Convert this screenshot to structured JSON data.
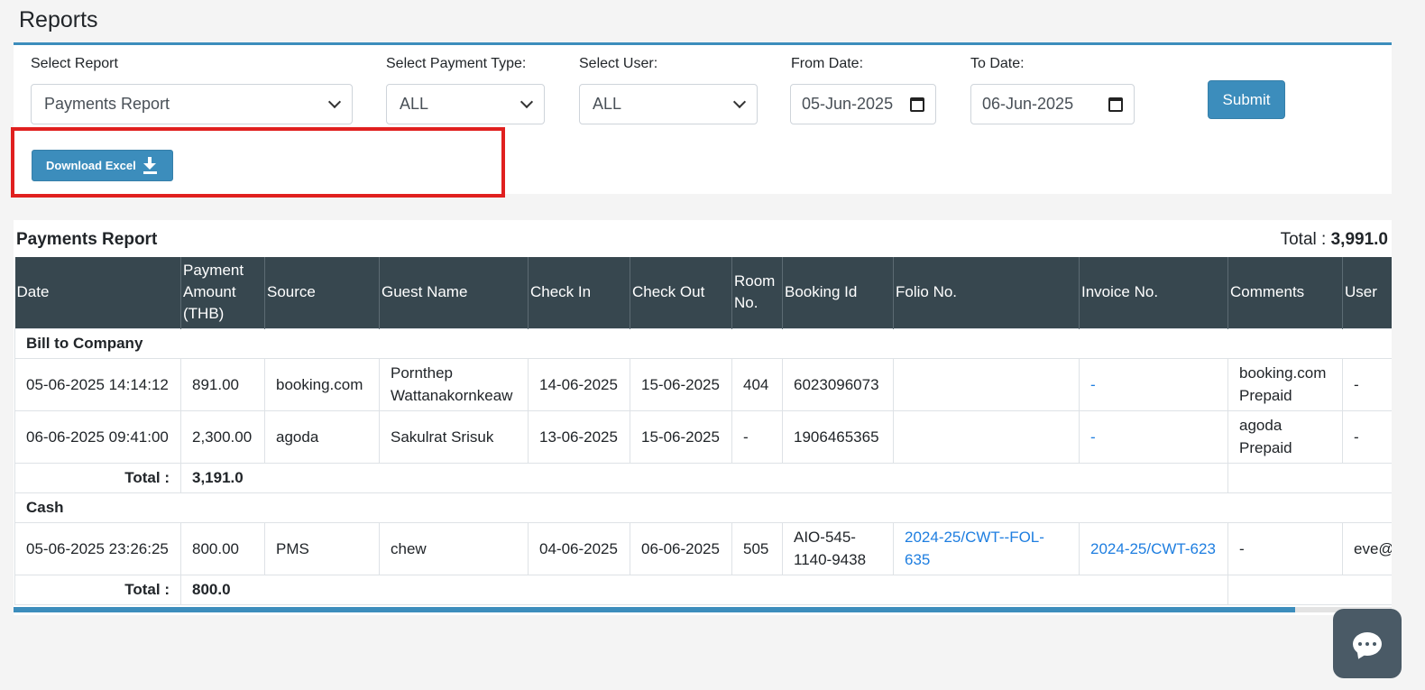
{
  "page": {
    "title": "Reports"
  },
  "filters": {
    "report_label": "Select Report",
    "report_value": "Payments Report",
    "payment_type_label": "Select Payment Type:",
    "payment_type_value": "ALL",
    "user_label": "Select User:",
    "user_value": "ALL",
    "from_label": "From Date:",
    "from_value": "05-Jun-2025",
    "to_label": "To Date:",
    "to_value": "06-Jun-2025",
    "submit_label": "Submit",
    "download_label": "Download Excel"
  },
  "report": {
    "title": "Payments Report",
    "total_label": "Total :",
    "total_value": "3,991.0",
    "columns": [
      "Date",
      "Payment Amount (THB)",
      "Source",
      "Guest Name",
      "Check In",
      "Check Out",
      "Room No.",
      "Booking Id",
      "Folio No.",
      "Invoice No.",
      "Comments",
      "User"
    ],
    "groups": [
      {
        "name": "Bill to Company",
        "rows": [
          {
            "date": "05-06-2025 14:14:12",
            "amount": "891.00",
            "source": "booking.com",
            "guest": "Pornthep Wattanakornkeaw",
            "check_in": "14-06-2025",
            "check_out": "15-06-2025",
            "room": "404",
            "booking_id": "6023096073",
            "folio": "",
            "invoice": "-",
            "comments": "booking.com Prepaid",
            "user": "-"
          },
          {
            "date": "06-06-2025 09:41:00",
            "amount": "2,300.00",
            "source": "agoda",
            "guest": "Sakulrat Srisuk",
            "check_in": "13-06-2025",
            "check_out": "15-06-2025",
            "room": "-",
            "booking_id": "1906465365",
            "folio": "",
            "invoice": "-",
            "comments": "agoda Prepaid",
            "user": "-"
          }
        ],
        "total_label": "Total :",
        "total": "3,191.0"
      },
      {
        "name": "Cash",
        "rows": [
          {
            "date": "05-06-2025 23:26:25",
            "amount": "800.00",
            "source": "PMS",
            "guest": "chew",
            "check_in": "04-06-2025",
            "check_out": "06-06-2025",
            "room": "505",
            "booking_id": "AIO-545-1140-9438",
            "folio": "2024-25/CWT--FOL-635",
            "invoice": "2024-25/CWT-623",
            "comments": "-",
            "user": "eve@"
          }
        ],
        "total_label": "Total :",
        "total": "800.0"
      }
    ]
  },
  "colors": {
    "accent": "#3c8dbc",
    "header_bg": "#37474f",
    "link": "#1e7ee0",
    "highlight": "#e0201f"
  },
  "icons": {
    "download": "download-icon",
    "calendar": "calendar-icon",
    "chat": "chat-icon"
  }
}
